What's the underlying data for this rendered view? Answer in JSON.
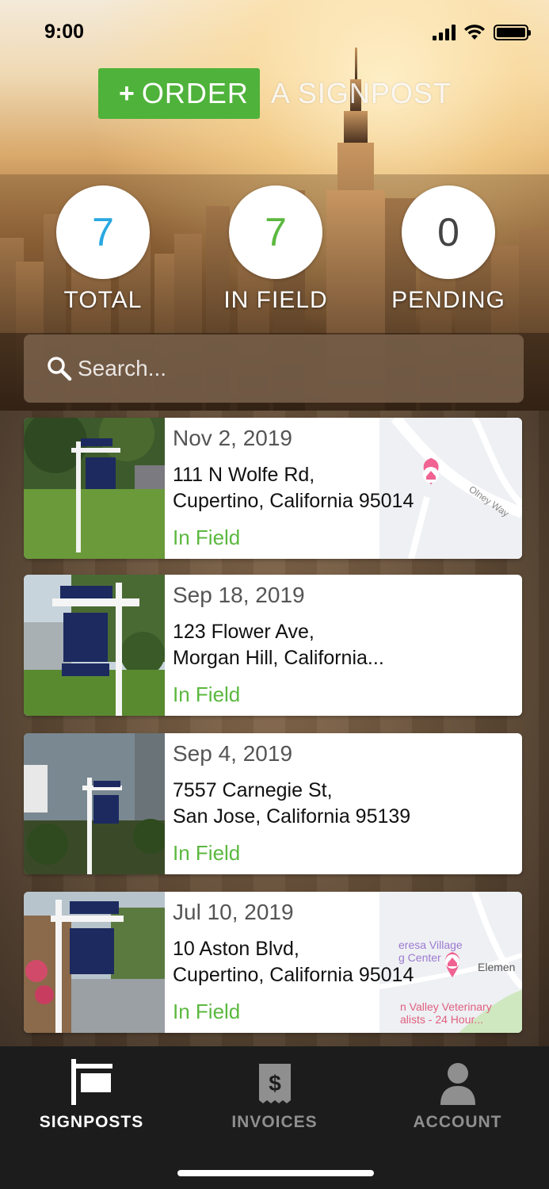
{
  "status_bar": {
    "time": "9:00"
  },
  "header": {
    "order_button": {
      "plus": "+",
      "label": "ORDER"
    },
    "order_suffix": "A SIGNPOST"
  },
  "stats": [
    {
      "value": "7",
      "label": "TOTAL",
      "color": "#29a8e0"
    },
    {
      "value": "7",
      "label": "IN FIELD",
      "color": "#5bb83f"
    },
    {
      "value": "0",
      "label": "PENDING",
      "color": "#444444"
    }
  ],
  "search": {
    "placeholder": "Search..."
  },
  "signposts": [
    {
      "date": "Nov 2, 2019",
      "address_line1": "111 N Wolfe Rd,",
      "address_line2": "Cupertino, California 95014",
      "status": "In Field",
      "map": {
        "street_label": "Olney Way",
        "extra_label": "",
        "extra_label2": ""
      }
    },
    {
      "date": "Sep 18, 2019",
      "address_line1": "123 Flower Ave,",
      "address_line2": "Morgan Hill, California...",
      "status": "In Field"
    },
    {
      "date": "Sep 4, 2019",
      "address_line1": "7557 Carnegie St,",
      "address_line2": "San Jose, California 95139",
      "status": "In Field"
    },
    {
      "date": "Jul 10, 2019",
      "address_line1": "10 Aston Blvd,",
      "address_line2": "Cupertino, California 95014",
      "status": "In Field",
      "map": {
        "street_label": "eresa Village",
        "extra_label": "g Center",
        "extra_label2": "Elemen",
        "extra_label3": "n Valley Veterinary",
        "extra_label4": "alists - 24 Hour..."
      }
    }
  ],
  "tabbar": {
    "tabs": [
      {
        "label": "SIGNPOSTS",
        "icon": "signpost-icon",
        "active": true
      },
      {
        "label": "INVOICES",
        "icon": "invoice-icon",
        "active": false
      },
      {
        "label": "ACCOUNT",
        "icon": "account-icon",
        "active": false
      }
    ]
  },
  "colors": {
    "accent_green": "#4fb23a",
    "status_green": "#5bb83f",
    "total_blue": "#29a8e0",
    "tabbar_bg": "#1c1c1c"
  }
}
